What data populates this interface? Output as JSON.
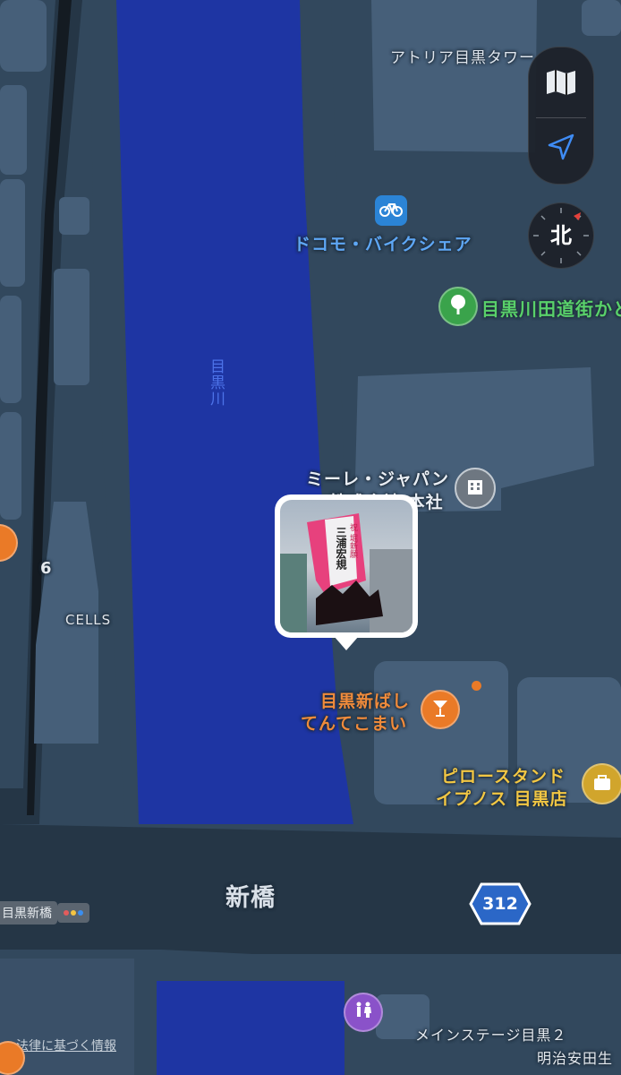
{
  "map": {
    "labels": {
      "building_top": "アトリア目黒タワー",
      "bike_share": "ドコモ・バイクシェア",
      "park": "目黒川田道街かど",
      "river": "目黒川",
      "company_line1": "ミーレ・ジャパン",
      "company_line2": "株式会社 本社",
      "bar_line1": "目黒新ばし",
      "bar_line2": "てんてこまい",
      "stand_line1": "ピロースタンド",
      "stand_line2": "イプノス 目黒店",
      "bridge": "新橋",
      "bus_stop": "目黒新橋",
      "stage": "メインステージ目黒２",
      "insurance": "明治安田生",
      "legal": "法律に基づく情報",
      "cells": "CELLS",
      "number_six": "6",
      "route": "312"
    },
    "controls": {
      "map_icon": "map-icon",
      "location_icon": "location-arrow-icon",
      "compass_label": "北"
    },
    "photo_pin": {
      "lantern_line1": "三浦宏規",
      "lantern_line2": "祝 堀新願"
    },
    "colors": {
      "water": "#1e35a3",
      "land": "#32485d",
      "block": "#465f79",
      "road": "#253646",
      "orange_poi": "#ea7a27",
      "green_poi": "#3aa34b",
      "blue_poi": "#2b84d6",
      "purple_poi": "#8a52c9",
      "route_shield": "#2b67c7"
    }
  }
}
